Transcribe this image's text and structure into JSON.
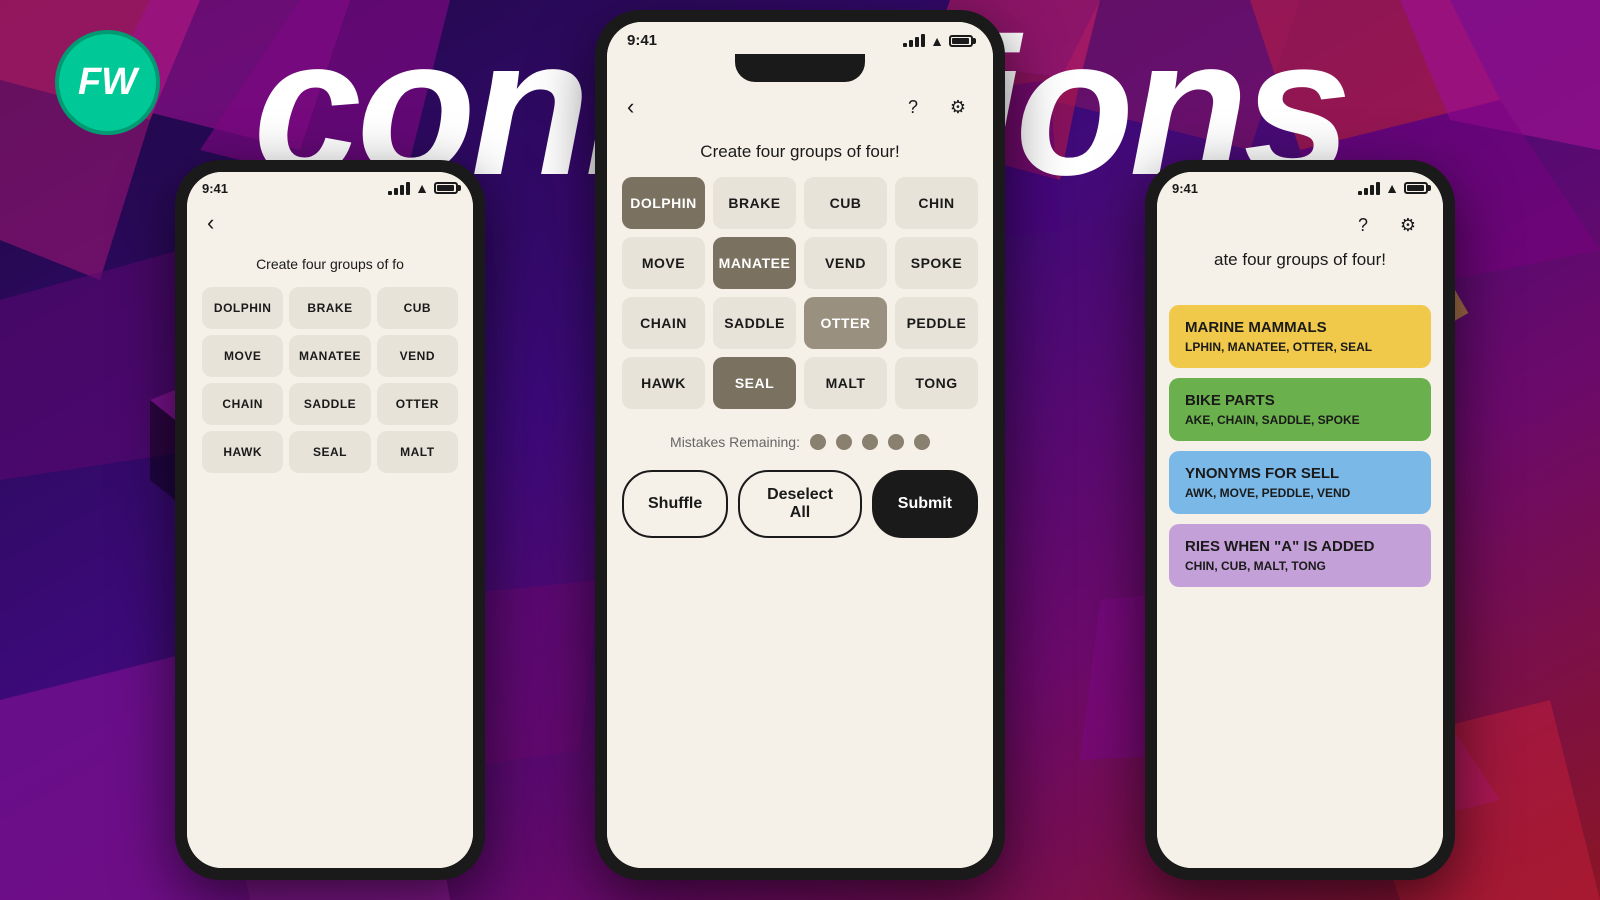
{
  "background": {
    "colors": [
      "#1a0a2e",
      "#2d0a5e",
      "#8b1a8b",
      "#c41e3a",
      "#ff6b35"
    ]
  },
  "logo": {
    "text": "FW",
    "bg_color": "#00c896"
  },
  "main_title": "Connections",
  "center_phone": {
    "status_time": "9:41",
    "game_title": "Create four groups of four!",
    "tiles": [
      {
        "word": "DOLPHIN",
        "state": "selected-dark"
      },
      {
        "word": "BRAKE",
        "state": "normal"
      },
      {
        "word": "CUB",
        "state": "normal"
      },
      {
        "word": "CHIN",
        "state": "normal"
      },
      {
        "word": "MOVE",
        "state": "normal"
      },
      {
        "word": "MANATEE",
        "state": "selected-dark"
      },
      {
        "word": "VEND",
        "state": "normal"
      },
      {
        "word": "SPOKE",
        "state": "normal"
      },
      {
        "word": "CHAIN",
        "state": "normal"
      },
      {
        "word": "SADDLE",
        "state": "normal"
      },
      {
        "word": "OTTER",
        "state": "selected-medium"
      },
      {
        "word": "PEDDLE",
        "state": "normal"
      },
      {
        "word": "HAWK",
        "state": "normal"
      },
      {
        "word": "SEAL",
        "state": "selected-dark"
      },
      {
        "word": "MALT",
        "state": "normal"
      },
      {
        "word": "TONG",
        "state": "normal"
      }
    ],
    "mistakes_label": "Mistakes Remaining:",
    "dots_count": 5,
    "buttons": {
      "shuffle": "Shuffle",
      "deselect": "Deselect All",
      "submit": "Submit"
    }
  },
  "left_phone": {
    "status_time": "9:41",
    "game_title": "Create four groups of fo",
    "tiles": [
      {
        "word": "DOLPHIN",
        "state": "normal"
      },
      {
        "word": "BRAKE",
        "state": "normal"
      },
      {
        "word": "CUB",
        "state": "normal"
      },
      {
        "word": "MOVE",
        "state": "normal"
      },
      {
        "word": "MANATEE",
        "state": "normal"
      },
      {
        "word": "VEND",
        "state": "normal"
      },
      {
        "word": "CHAIN",
        "state": "normal"
      },
      {
        "word": "SADDLE",
        "state": "normal"
      },
      {
        "word": "OTTER",
        "state": "normal"
      },
      {
        "word": "HAWK",
        "state": "normal"
      },
      {
        "word": "SEAL",
        "state": "normal"
      },
      {
        "word": "MALT",
        "state": "normal"
      }
    ]
  },
  "right_phone": {
    "status_time": "9:41",
    "game_title": "ate four groups of four!",
    "results": [
      {
        "category": "MARINE MAMMALS",
        "words": "LPHIN, MANATEE, OTTER, SEAL",
        "color": "yellow"
      },
      {
        "category": "BIKE PARTS",
        "words": "AKE, CHAIN, SADDLE, SPOKE",
        "color": "green"
      },
      {
        "category": "YNONYMS FOR SELL",
        "words": "AWK, MOVE, PEDDLE, VEND",
        "color": "blue-partial"
      },
      {
        "category": "RIES WHEN \"A\" IS ADDED",
        "words": "CHIN, CUB, MALT, TONG",
        "color": "purple-partial"
      }
    ]
  }
}
